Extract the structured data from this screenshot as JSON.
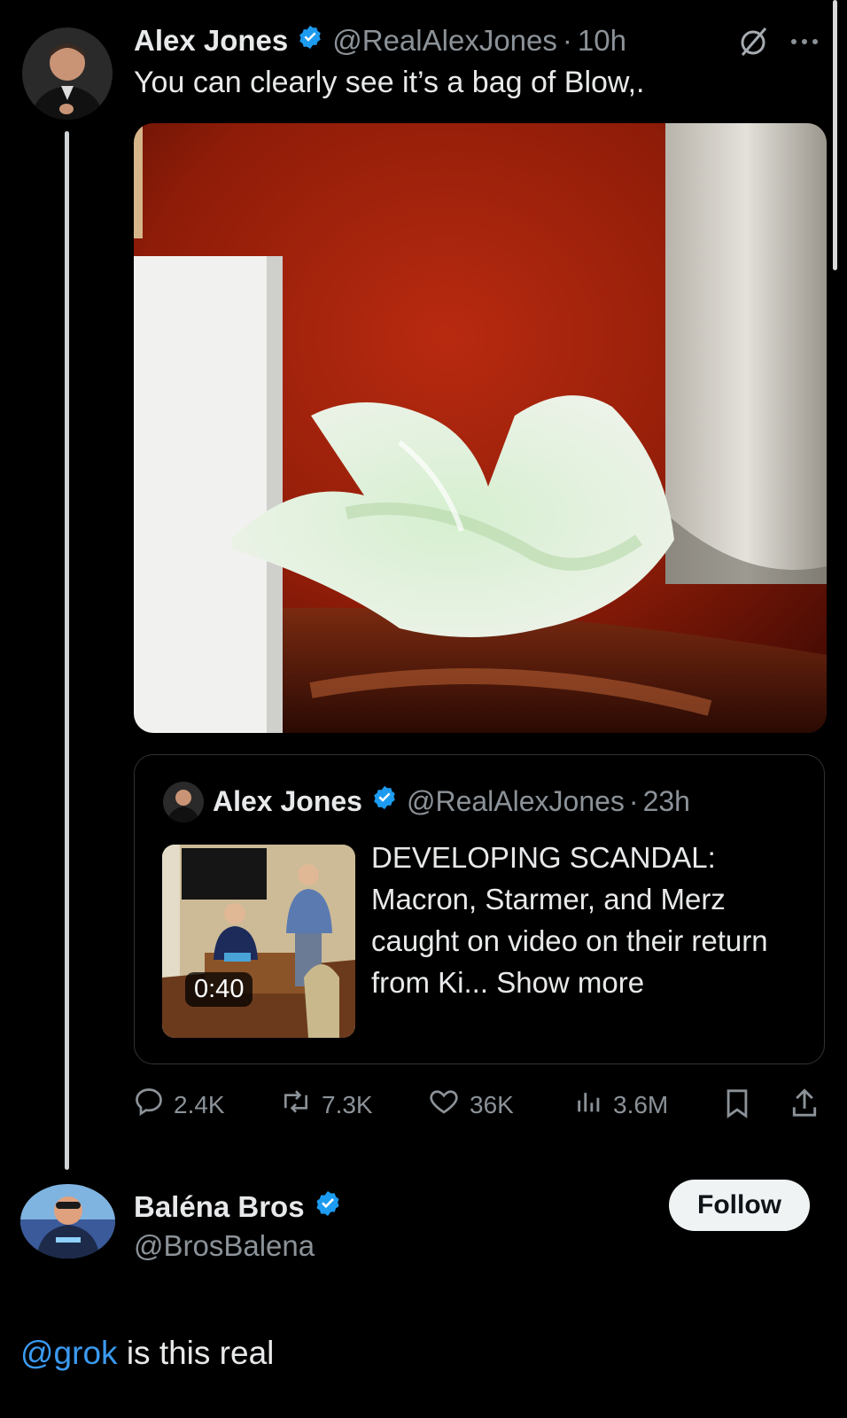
{
  "thread_tweet": {
    "author_name": "Alex Jones",
    "handle": "@RealAlexJones",
    "separator": "·",
    "time": "10h",
    "text": "You can clearly see it’s a bag of Blow,.",
    "media_alt": "photo of a crumpled white plastic bag on a red wooden table",
    "quoted_tweet": {
      "author_name": "Alex Jones",
      "handle": "@RealAlexJones",
      "separator": "·",
      "time": "23h",
      "text": "DEVELOPING SCANDAL: Macron, Starmer, and Merz caught on video on their return from Ki...",
      "show_more": "Show more",
      "video_duration": "0:40"
    },
    "actions": {
      "replies": "2.4K",
      "reposts": "7.3K",
      "likes": "36K",
      "views": "3.6M"
    }
  },
  "reply_tweet": {
    "author_name": "Baléna Bros",
    "handle": "@BrosBalena",
    "follow_label": "Follow",
    "mention": "@grok",
    "text_rest": " is this real"
  },
  "colors": {
    "background": "#000000",
    "text": "#e7e9ea",
    "muted": "#8b9298",
    "verified": "#1d9bf0",
    "link": "#3a9af0"
  },
  "icons": [
    "verified-badge-icon",
    "grok-slash-icon",
    "more-icon",
    "reply-icon",
    "repost-icon",
    "like-icon",
    "views-icon",
    "bookmark-icon",
    "share-icon"
  ]
}
